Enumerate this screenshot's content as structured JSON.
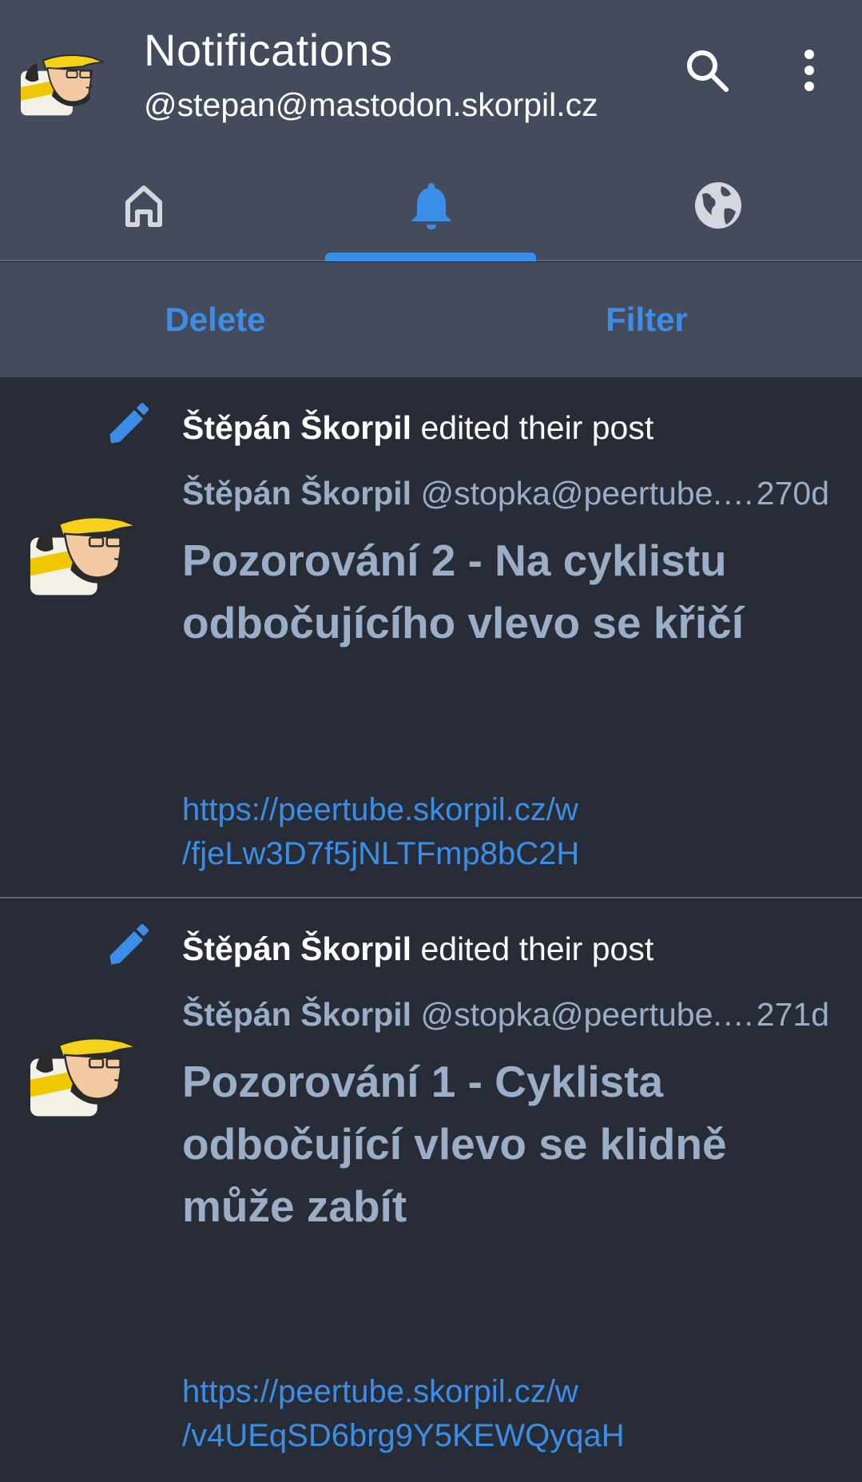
{
  "header": {
    "title": "Notifications",
    "account": "@stepan@mastodon.skorpil.cz"
  },
  "tabs": [
    {
      "name": "home",
      "icon": "home-icon",
      "active": false
    },
    {
      "name": "notifications",
      "icon": "bell-icon",
      "active": true
    },
    {
      "name": "federated",
      "icon": "globe-icon",
      "active": false
    }
  ],
  "actions": {
    "delete_label": "Delete",
    "filter_label": "Filter"
  },
  "notifications": [
    {
      "actor": "Štěpán Škorpil",
      "action_text": "edited their post",
      "author_name": "Štěpán Škorpil",
      "author_handle": "@stopka@peertube.…",
      "time": "270d",
      "title": "Pozorování 2 - Na cyklistu odbočujícího vlevo se křičí",
      "link_line1": "https://peertube.skorpil.cz/w",
      "link_line2": "/fjeLw3D7f5jNLTFmp8bC2H"
    },
    {
      "actor": "Štěpán Škorpil",
      "action_text": "edited their post",
      "author_name": "Štěpán Škorpil",
      "author_handle": "@stopka@peertube.…",
      "time": "271d",
      "title": "Pozorování 1 - Cyklista odbočující vlevo se klidně může zabít",
      "link_line1": "https://peertube.skorpil.cz/w",
      "link_line2": "/v4UEqSD6brg9Y5KEWQyqaH"
    }
  ],
  "colors": {
    "background": "#282c37",
    "bar": "#444b5d",
    "accent": "#3b8ee8",
    "secondary_text": "#9baec8"
  }
}
